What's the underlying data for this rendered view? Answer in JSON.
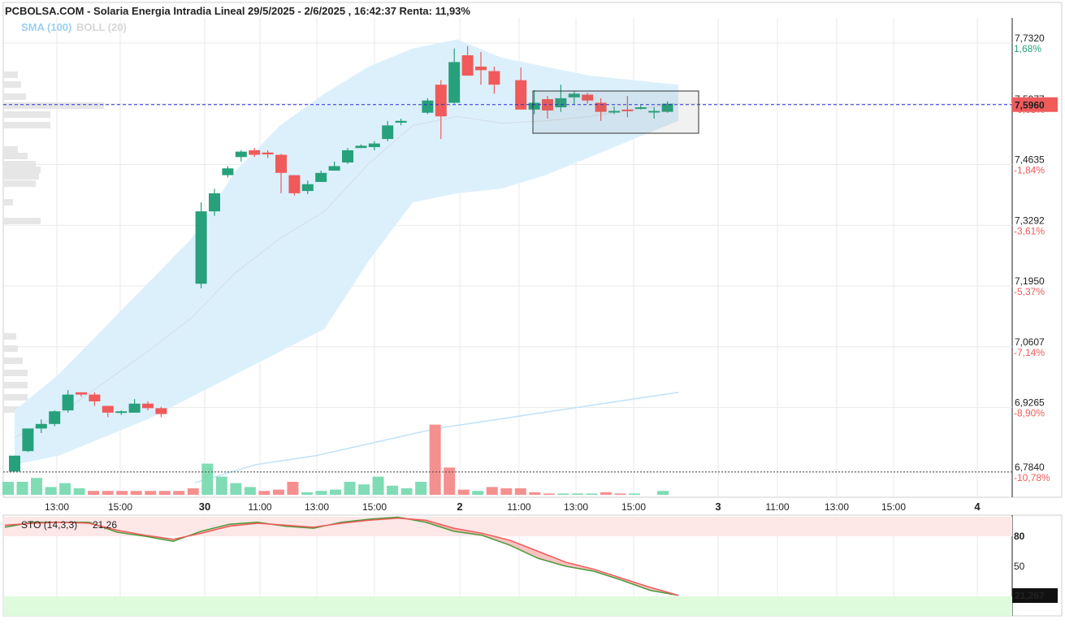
{
  "header": {
    "title": "PCBOLSA.COM - Solaria Energia Intradia Lineal 29/5/2025 - 2/6/2025 , 16:42:37 Renta: 11,93%",
    "indicator_sma": "SMA (100)",
    "indicator_boll": "BOLL (20)"
  },
  "colors": {
    "up": "#26a17b",
    "down": "#f05a5a",
    "band_fill": "#dcf0fc",
    "sma_line": "#bfe2f7",
    "price_line": "#2b2bd6",
    "volume_up": "#80dcb5",
    "volume_down": "#f4908f"
  },
  "price_axis": {
    "ticks": [
      {
        "value": 7.732,
        "label": "7,7320",
        "pct": "1,68%",
        "dir": "up"
      },
      {
        "value": 7.5977,
        "label": "7,5977",
        "pct": "-0,08%",
        "dir": "down"
      },
      {
        "value": 7.4635,
        "label": "7,4635",
        "pct": "-1,84%",
        "dir": "down"
      },
      {
        "value": 7.3292,
        "label": "7,3292",
        "pct": "-3,61%",
        "dir": "down"
      },
      {
        "value": 7.195,
        "label": "7,1950",
        "pct": "-5,37%",
        "dir": "down"
      },
      {
        "value": 7.0607,
        "label": "7,0607",
        "pct": "-7,14%",
        "dir": "down"
      },
      {
        "value": 6.9265,
        "label": "6,9265",
        "pct": "-8,90%",
        "dir": "down"
      },
      {
        "value": 6.784,
        "label": "6,7840",
        "pct": "-10,78%",
        "dir": "down"
      }
    ],
    "current_price": 7.596,
    "current_price_label": "7,5960",
    "reference_level": 6.784
  },
  "time_axis": [
    {
      "label": "13:00",
      "bold": false
    },
    {
      "label": "15:00",
      "bold": false
    },
    {
      "label": "30",
      "bold": true
    },
    {
      "label": "11:00",
      "bold": false
    },
    {
      "label": "13:00",
      "bold": false
    },
    {
      "label": "15:00",
      "bold": false
    },
    {
      "label": "2",
      "bold": true
    },
    {
      "label": "11:00",
      "bold": false
    },
    {
      "label": "13:00",
      "bold": false
    },
    {
      "label": "15:00",
      "bold": false
    },
    {
      "label": "3",
      "bold": true
    },
    {
      "label": "11:00",
      "bold": false
    },
    {
      "label": "13:00",
      "bold": false
    },
    {
      "label": "15:00",
      "bold": false
    },
    {
      "label": "4",
      "bold": true
    }
  ],
  "chart_data": {
    "type": "candlestick",
    "title": "PCBOLSA.COM - Solaria Energia Intradia Lineal 29/5/2025 - 2/6/2025 , 16:42:37 Renta: 11,93%",
    "candles": [
      {
        "o": 6.785,
        "h": 6.82,
        "l": 6.785,
        "c": 6.82
      },
      {
        "o": 6.83,
        "h": 6.88,
        "l": 6.828,
        "c": 6.88
      },
      {
        "o": 6.88,
        "h": 6.9,
        "l": 6.87,
        "c": 6.89
      },
      {
        "o": 6.89,
        "h": 6.92,
        "l": 6.885,
        "c": 6.918
      },
      {
        "o": 6.92,
        "h": 6.965,
        "l": 6.915,
        "c": 6.955
      },
      {
        "o": 6.96,
        "h": 6.96,
        "l": 6.95,
        "c": 6.955
      },
      {
        "o": 6.955,
        "h": 6.96,
        "l": 6.93,
        "c": 6.94
      },
      {
        "o": 6.93,
        "h": 6.93,
        "l": 6.905,
        "c": 6.915
      },
      {
        "o": 6.915,
        "h": 6.92,
        "l": 6.91,
        "c": 6.918
      },
      {
        "o": 6.915,
        "h": 6.945,
        "l": 6.915,
        "c": 6.935
      },
      {
        "o": 6.935,
        "h": 6.94,
        "l": 6.92,
        "c": 6.925
      },
      {
        "o": 6.925,
        "h": 6.928,
        "l": 6.905,
        "c": 6.912
      },
      {
        "o": 7.2,
        "h": 7.38,
        "l": 7.19,
        "c": 7.36
      },
      {
        "o": 7.36,
        "h": 7.41,
        "l": 7.35,
        "c": 7.4
      },
      {
        "o": 7.44,
        "h": 7.46,
        "l": 7.435,
        "c": 7.455
      },
      {
        "o": 7.48,
        "h": 7.495,
        "l": 7.47,
        "c": 7.492
      },
      {
        "o": 7.495,
        "h": 7.5,
        "l": 7.48,
        "c": 7.485
      },
      {
        "o": 7.49,
        "h": 7.495,
        "l": 7.478,
        "c": 7.486
      },
      {
        "o": 7.485,
        "h": 7.487,
        "l": 7.4,
        "c": 7.445
      },
      {
        "o": 7.44,
        "h": 7.44,
        "l": 7.395,
        "c": 7.4
      },
      {
        "o": 7.405,
        "h": 7.428,
        "l": 7.398,
        "c": 7.42
      },
      {
        "o": 7.425,
        "h": 7.45,
        "l": 7.425,
        "c": 7.445
      },
      {
        "o": 7.45,
        "h": 7.47,
        "l": 7.45,
        "c": 7.46
      },
      {
        "o": 7.468,
        "h": 7.5,
        "l": 7.465,
        "c": 7.495
      },
      {
        "o": 7.5,
        "h": 7.508,
        "l": 7.5,
        "c": 7.505
      },
      {
        "o": 7.502,
        "h": 7.515,
        "l": 7.495,
        "c": 7.51
      },
      {
        "o": 7.52,
        "h": 7.56,
        "l": 7.515,
        "c": 7.55
      },
      {
        "o": 7.556,
        "h": 7.565,
        "l": 7.55,
        "c": 7.56
      },
      {
        "o": 7.578,
        "h": 7.61,
        "l": 7.575,
        "c": 7.605
      },
      {
        "o": 7.64,
        "h": 7.65,
        "l": 7.52,
        "c": 7.57
      },
      {
        "o": 7.6,
        "h": 7.72,
        "l": 7.598,
        "c": 7.69
      },
      {
        "o": 7.705,
        "h": 7.725,
        "l": 7.66,
        "c": 7.66
      },
      {
        "o": 7.68,
        "h": 7.712,
        "l": 7.64,
        "c": 7.672
      },
      {
        "o": 7.67,
        "h": 7.68,
        "l": 7.62,
        "c": 7.64
      },
      {
        "o": 7.65,
        "h": 7.678,
        "l": 7.59,
        "c": 7.585
      },
      {
        "o": 7.585,
        "h": 7.628,
        "l": 7.575,
        "c": 7.6
      },
      {
        "o": 7.608,
        "h": 7.615,
        "l": 7.565,
        "c": 7.583
      },
      {
        "o": 7.59,
        "h": 7.64,
        "l": 7.58,
        "c": 7.61
      },
      {
        "o": 7.612,
        "h": 7.625,
        "l": 7.595,
        "c": 7.62
      },
      {
        "o": 7.618,
        "h": 7.622,
        "l": 7.598,
        "c": 7.605
      },
      {
        "o": 7.6,
        "h": 7.61,
        "l": 7.56,
        "c": 7.58
      },
      {
        "o": 7.58,
        "h": 7.592,
        "l": 7.575,
        "c": 7.582
      },
      {
        "o": 7.585,
        "h": 7.615,
        "l": 7.568,
        "c": 7.583
      },
      {
        "o": 7.59,
        "h": 7.595,
        "l": 7.585,
        "c": 7.59
      },
      {
        "o": 7.58,
        "h": 7.59,
        "l": 7.565,
        "c": 7.582
      },
      {
        "o": 7.58,
        "h": 7.603,
        "l": 7.578,
        "c": 7.598
      }
    ],
    "candle_x_slots": [
      0,
      1,
      2,
      3,
      4,
      5,
      6,
      7,
      8,
      9,
      10,
      11,
      14,
      15,
      16,
      17,
      18,
      19,
      20,
      21,
      22,
      23,
      24,
      25,
      26,
      27,
      28,
      29,
      31,
      32,
      33,
      34,
      35,
      36,
      38,
      39,
      40,
      41,
      42,
      43,
      44,
      45,
      46,
      47,
      48,
      49
    ],
    "volumes": [
      10,
      10,
      13,
      6,
      9,
      5,
      3,
      3,
      3,
      3,
      3,
      3,
      3,
      5,
      24,
      14,
      9,
      6,
      3,
      4,
      10,
      2,
      3,
      4,
      10,
      8,
      14,
      7,
      5,
      10,
      54,
      21,
      4,
      3,
      6,
      5,
      5,
      2,
      1,
      1,
      1,
      1,
      2,
      1,
      1,
      0,
      3
    ],
    "volume_dir": [
      "up",
      "up",
      "up",
      "up",
      "up",
      "up",
      "down",
      "down",
      "down",
      "down",
      "down",
      "down",
      "down",
      "down",
      "up",
      "up",
      "up",
      "up",
      "down",
      "down",
      "down",
      "up",
      "up",
      "up",
      "up",
      "up",
      "up",
      "up",
      "up",
      "up",
      "down",
      "down",
      "down",
      "up",
      "down",
      "down",
      "down",
      "down",
      "down",
      "up",
      "up",
      "up",
      "down",
      "down",
      "up",
      "up",
      "up"
    ],
    "bollinger_upper": [
      6.92,
      7.0,
      7.1,
      7.2,
      7.3,
      7.45,
      7.55,
      7.62,
      7.68,
      7.72,
      7.74,
      7.7,
      7.68,
      7.66,
      7.65,
      7.64
    ],
    "bollinger_lower": [
      6.8,
      6.82,
      6.86,
      6.9,
      6.95,
      7.0,
      7.05,
      7.1,
      7.25,
      7.38,
      7.4,
      7.41,
      7.44,
      7.48,
      7.52,
      7.56
    ],
    "sma_100": [
      6.76,
      6.8,
      6.82,
      6.85,
      6.88,
      6.9,
      6.92,
      6.94,
      6.96
    ],
    "stochastic": {
      "label": "STO (14,3,3)",
      "value": "21,26",
      "value_box": "21,267",
      "levels": [
        {
          "value": 80,
          "label": "80"
        },
        {
          "value": 50,
          "label": "50"
        }
      ],
      "k": [
        89,
        94,
        94,
        94,
        84,
        80,
        75,
        85,
        92,
        94,
        90,
        88,
        94,
        97,
        99,
        94,
        85,
        81,
        71,
        58,
        50,
        45,
        36,
        26,
        21
      ],
      "d": [
        91,
        93,
        94,
        93,
        86,
        81,
        77,
        83,
        90,
        93,
        91,
        89,
        93,
        96,
        98,
        96,
        88,
        83,
        76,
        65,
        54,
        47,
        38,
        29,
        21
      ]
    }
  }
}
